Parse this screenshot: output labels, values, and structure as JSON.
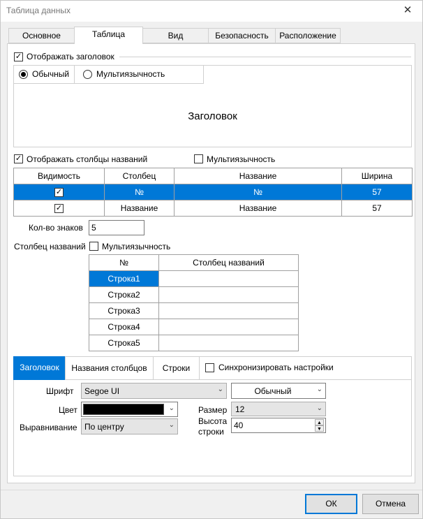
{
  "window": {
    "title": "Таблица данных",
    "close_glyph": "✕"
  },
  "tabs": [
    "Основное",
    "Таблица",
    "Вид",
    "Безопасность",
    "Расположение"
  ],
  "header_section": {
    "show_header_label": "Отображать заголовок",
    "show_header_checked": true,
    "radio_normal": "Обычный",
    "radio_multi": "Мультиязычность",
    "preview_text": "Заголовок"
  },
  "columns_section": {
    "show_columns_label": "Отображать столбцы названий",
    "multilang_label": "Мультиязычность",
    "headers": [
      "Видимость",
      "Столбец",
      "Название",
      "Ширина"
    ],
    "rows": [
      {
        "visible": true,
        "column": "№",
        "name": "№",
        "width": "57",
        "selected": true
      },
      {
        "visible": true,
        "column": "Название",
        "name": "Название",
        "width": "57",
        "selected": false
      }
    ]
  },
  "char_count": {
    "label": "Кол-во знаков",
    "value": "5"
  },
  "names_column": {
    "label": "Столбец названий",
    "multilang_label": "Мультиязычность",
    "headers": [
      "№",
      "Столбец названий"
    ],
    "rows": [
      "Строка1",
      "Строка2",
      "Строка3",
      "Строка4",
      "Строка5"
    ]
  },
  "style_tabs": [
    "Заголовок",
    "Названия столбцов",
    "Строки"
  ],
  "sync_label": "Синхронизировать настройки",
  "font": {
    "label": "Шрифт",
    "value": "Segoe UI",
    "style": "Обычный"
  },
  "color": {
    "label": "Цвет",
    "swatch": "#000000"
  },
  "size": {
    "label": "Размер",
    "value": "12"
  },
  "align": {
    "label": "Выравнивание",
    "value": "По центру"
  },
  "row_height": {
    "label_1": "Высота",
    "label_2": "строки",
    "value": "40"
  },
  "buttons": {
    "ok": "ОК",
    "cancel": "Отмена"
  },
  "colors": {
    "accent": "#0078d7",
    "border": "#d0d0d0"
  }
}
